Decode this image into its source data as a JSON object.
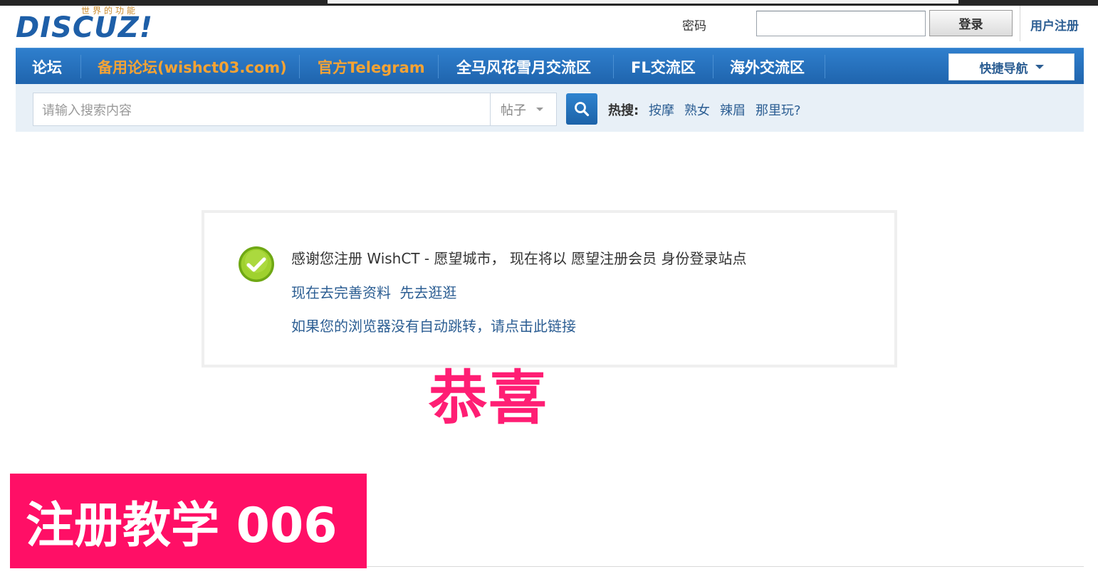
{
  "logo": {
    "tagline": "世界的功能",
    "brand": "DISCUZ!"
  },
  "login": {
    "password_label": "密码",
    "password_value": "",
    "login_button": "登录",
    "register_link": "用户注册"
  },
  "nav": {
    "items": [
      {
        "label": "论坛",
        "highlight": false
      },
      {
        "label": "备用论坛(wishct03.com)",
        "highlight": true
      },
      {
        "label": "官方Telegram",
        "highlight": true
      },
      {
        "label": "全马风花雪月交流区",
        "highlight": false
      },
      {
        "label": "FL交流区",
        "highlight": false
      },
      {
        "label": "海外交流区",
        "highlight": false
      }
    ],
    "quick_nav": "快捷导航"
  },
  "search": {
    "placeholder": "请输入搜索内容",
    "scope": "帖子",
    "hot_label": "热搜:",
    "hot_terms": [
      "按摩",
      "熟女",
      "辣眉",
      "那里玩?"
    ]
  },
  "message": {
    "main": "感谢您注册 WishCT - 愿望城市， 现在将以 愿望注册会员 身份登录站点",
    "link_profile": "现在去完善资料",
    "link_browse": "先去逛逛",
    "redirect": "如果您的浏览器没有自动跳转，请点击此链接"
  },
  "overlay": {
    "congrats": "恭喜",
    "tutorial_banner": "注册教学  006"
  },
  "colors": {
    "nav_blue": "#1f64ad",
    "link_blue": "#2c5e93",
    "nav_orange": "#f5a334",
    "overlay_pink": "#ff1e74",
    "banner_pink": "#ff0f66",
    "success_green": "#8cc21f"
  }
}
